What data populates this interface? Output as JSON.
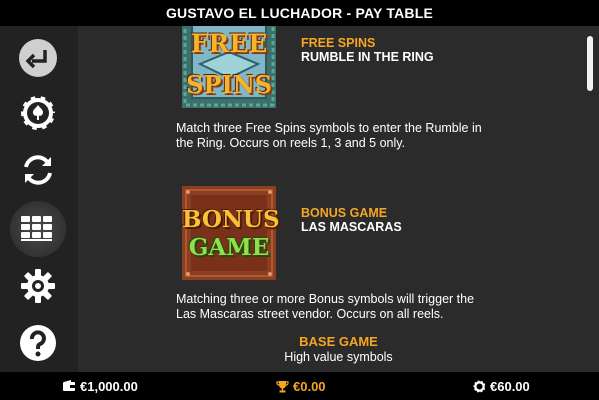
{
  "header": {
    "title": "GUSTAVO EL LUCHADOR - PAY TABLE"
  },
  "sidebar": {
    "items": [
      {
        "icon": "back-arrow-icon"
      },
      {
        "icon": "chip-icon"
      },
      {
        "icon": "autoplay-icon"
      },
      {
        "icon": "paytable-grid-icon",
        "active": true
      },
      {
        "icon": "settings-gear-icon"
      },
      {
        "icon": "help-icon"
      }
    ]
  },
  "content": {
    "free_spins": {
      "tile_top": "FREE",
      "tile_bottom": "SPINS",
      "title": "FREE SPINS",
      "subtitle": "RUMBLE IN THE RING",
      "description": "Match three Free Spins symbols to enter the Rumble in the Ring. Occurs on reels 1, 3 and 5 only."
    },
    "bonus_game": {
      "tile_top": "BONUS",
      "tile_bottom": "GAME",
      "title": "BONUS GAME",
      "subtitle": "LAS MASCARAS",
      "description": "Matching three or more Bonus symbols will trigger the Las Mascaras street vendor. Occurs on all reels."
    },
    "base_game": {
      "title": "BASE GAME",
      "subtitle": "High value symbols"
    }
  },
  "footer": {
    "balance": "€1,000.00",
    "win": "€0.00",
    "bet": "€60.00"
  },
  "colors": {
    "accent": "#f5a623",
    "background": "#2b2b2b",
    "bar": "#000000"
  }
}
